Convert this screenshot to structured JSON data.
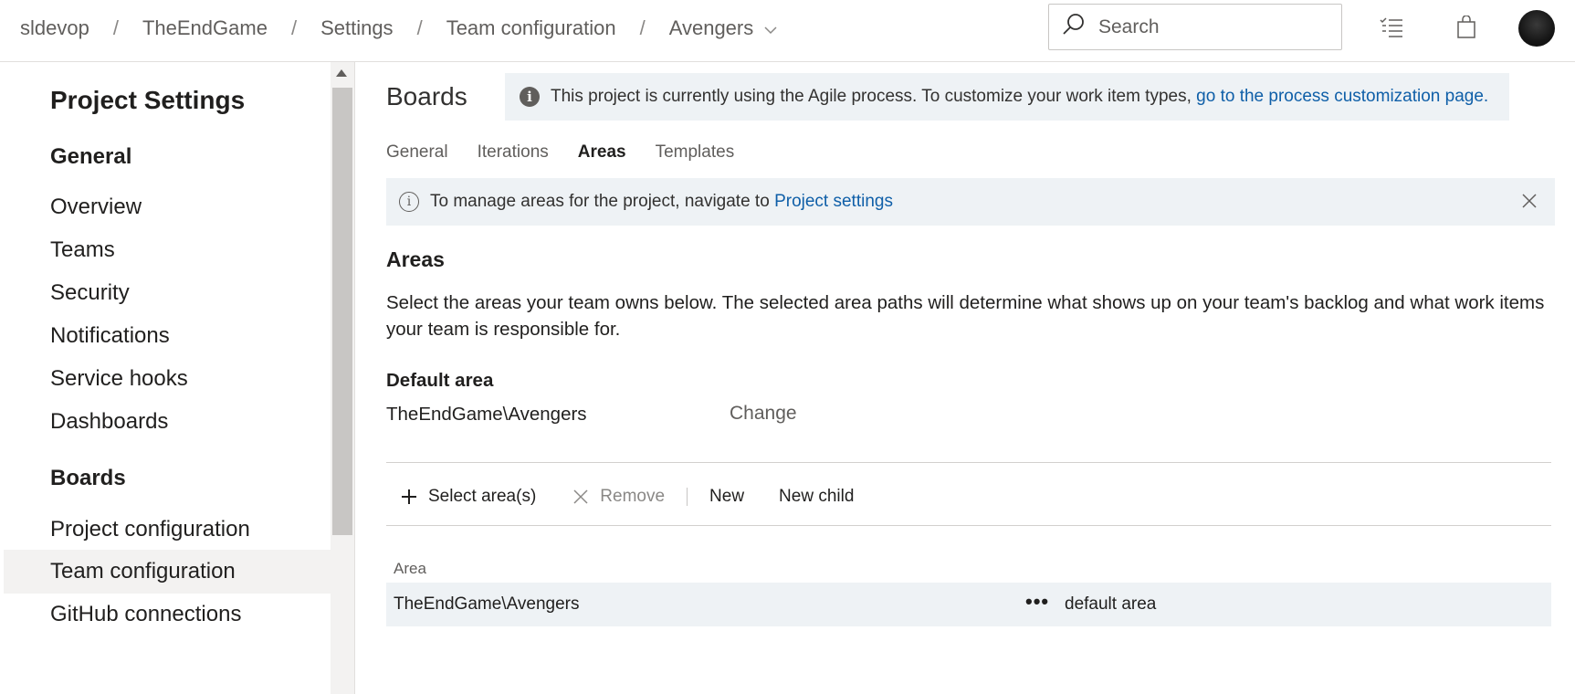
{
  "breadcrumb": {
    "items": [
      "sldevop",
      "TheEndGame",
      "Settings",
      "Team configuration",
      "Avengers"
    ],
    "separator": "/"
  },
  "search": {
    "placeholder": "Search"
  },
  "header_icons": [
    "work-items-list-icon",
    "shopping-bag-icon",
    "user-avatar"
  ],
  "sidebar": {
    "title": "Project Settings",
    "sections": [
      {
        "heading": "General",
        "items": [
          "Overview",
          "Teams",
          "Security",
          "Notifications",
          "Service hooks",
          "Dashboards"
        ]
      },
      {
        "heading": "Boards",
        "items": [
          "Project configuration",
          "Team configuration",
          "GitHub connections"
        ]
      }
    ],
    "selected": "Team configuration"
  },
  "main": {
    "title": "Boards",
    "process_banner": {
      "text": "This project is currently using the Agile process. To customize your work item types,",
      "link": "go to the process customization page."
    },
    "tabs": [
      "General",
      "Iterations",
      "Areas",
      "Templates"
    ],
    "active_tab": "Areas",
    "areas_info": {
      "text": "To manage areas for the project, navigate to",
      "link": "Project settings"
    },
    "areas_heading": "Areas",
    "areas_description": "Select the areas your team owns below. The selected area paths will determine what shows up on your team's backlog and what work items your team is responsible for.",
    "default_area_label": "Default area",
    "default_area_value": "TheEndGame\\Avengers",
    "change_label": "Change",
    "toolbar": {
      "select_areas": "Select area(s)",
      "remove": "Remove",
      "new": "New",
      "new_child": "New child"
    },
    "table": {
      "column_area": "Area",
      "rows": [
        {
          "area": "TheEndGame\\Avengers",
          "more": "•••",
          "tag": "default area"
        }
      ]
    }
  },
  "colors": {
    "accent_link": "#0f5fa8",
    "banner_bg": "#eef2f5",
    "selected_bg": "#f3f2f1"
  }
}
